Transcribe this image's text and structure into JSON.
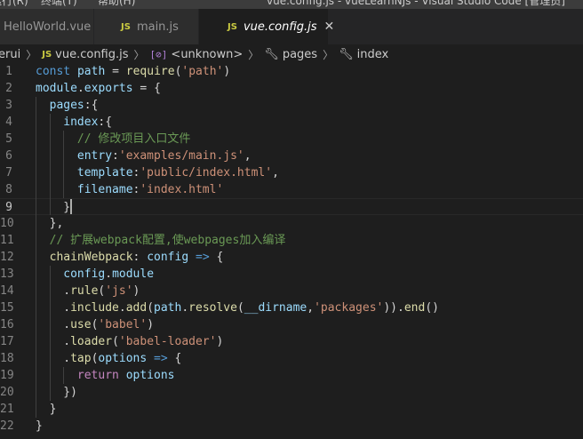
{
  "titlebar": {
    "menu_left": "运行(R)",
    "menu_right": "终端(T)",
    "menu_help": "帮助(H)",
    "window_title": "vue.config.js - vueLearnNJs - Visual Studio Code [管理员]"
  },
  "tabs": [
    {
      "label": "HelloWorld.vue",
      "icon": "",
      "active": false
    },
    {
      "label": "main.js",
      "icon": "JS",
      "active": false
    },
    {
      "label": "vue.config.js",
      "icon": "JS",
      "active": true,
      "close": "✕"
    }
  ],
  "breadcrumb": {
    "root": "erui",
    "file_icon": "JS",
    "file": "vue.config.js",
    "symbol_icon": "[⊘]",
    "symbol": "<unknown>",
    "prop1": "pages",
    "prop2": "index"
  },
  "editor": {
    "current_line": 9,
    "lines": [
      {
        "n": "1",
        "indent": 0,
        "tokens": [
          [
            "kw",
            "const "
          ],
          [
            "var",
            "path"
          ],
          [
            "op",
            " = "
          ],
          [
            "fn",
            "require"
          ],
          [
            "pun",
            "("
          ],
          [
            "str",
            "'path'"
          ],
          [
            "pun",
            ")"
          ]
        ]
      },
      {
        "n": "2",
        "indent": 0,
        "tokens": [
          [
            "var",
            "module"
          ],
          [
            "pun",
            "."
          ],
          [
            "var",
            "exports"
          ],
          [
            "op",
            " = "
          ],
          [
            "pun",
            "{"
          ]
        ]
      },
      {
        "n": "3",
        "indent": 1,
        "tokens": [
          [
            "var",
            "pages"
          ],
          [
            "pun",
            ":{"
          ]
        ]
      },
      {
        "n": "4",
        "indent": 2,
        "tokens": [
          [
            "var",
            "index"
          ],
          [
            "pun",
            ":{"
          ]
        ]
      },
      {
        "n": "5",
        "indent": 3,
        "tokens": [
          [
            "cmt",
            "// 修改项目入口文件"
          ]
        ]
      },
      {
        "n": "6",
        "indent": 3,
        "tokens": [
          [
            "var",
            "entry"
          ],
          [
            "pun",
            ":"
          ],
          [
            "str",
            "'examples/main.js'"
          ],
          [
            "pun",
            ","
          ]
        ]
      },
      {
        "n": "7",
        "indent": 3,
        "tokens": [
          [
            "var",
            "template"
          ],
          [
            "pun",
            ":"
          ],
          [
            "str",
            "'public/index.html'"
          ],
          [
            "pun",
            ","
          ]
        ]
      },
      {
        "n": "8",
        "indent": 3,
        "tokens": [
          [
            "var",
            "filename"
          ],
          [
            "pun",
            ":"
          ],
          [
            "str",
            "'index.html'"
          ]
        ]
      },
      {
        "n": "9",
        "indent": 2,
        "tokens": [
          [
            "pun",
            "}"
          ]
        ]
      },
      {
        "n": "10",
        "indent": 1,
        "tokens": [
          [
            "pun",
            "},"
          ]
        ]
      },
      {
        "n": "11",
        "indent": 1,
        "tokens": [
          [
            "cmt",
            "// 扩展webpack配置,使webpages加入编译"
          ]
        ]
      },
      {
        "n": "12",
        "indent": 1,
        "tokens": [
          [
            "fn",
            "chainWebpack"
          ],
          [
            "pun",
            ": "
          ],
          [
            "var",
            "config"
          ],
          [
            "op",
            " "
          ],
          [
            "kw",
            "=>"
          ],
          [
            "pun",
            " {"
          ]
        ]
      },
      {
        "n": "13",
        "indent": 2,
        "tokens": [
          [
            "var",
            "config"
          ],
          [
            "pun",
            "."
          ],
          [
            "var",
            "module"
          ]
        ]
      },
      {
        "n": "14",
        "indent": 2,
        "tokens": [
          [
            "pun",
            "."
          ],
          [
            "fn",
            "rule"
          ],
          [
            "pun",
            "("
          ],
          [
            "str",
            "'js'"
          ],
          [
            "pun",
            ")"
          ]
        ]
      },
      {
        "n": "15",
        "indent": 2,
        "tokens": [
          [
            "pun",
            "."
          ],
          [
            "fn",
            "include"
          ],
          [
            "pun",
            "."
          ],
          [
            "fn",
            "add"
          ],
          [
            "pun",
            "("
          ],
          [
            "var",
            "path"
          ],
          [
            "pun",
            "."
          ],
          [
            "fn",
            "resolve"
          ],
          [
            "pun",
            "("
          ],
          [
            "var",
            "__dirname"
          ],
          [
            "pun",
            ","
          ],
          [
            "str",
            "'packages'"
          ],
          [
            "pun",
            "))."
          ],
          [
            "fn",
            "end"
          ],
          [
            "pun",
            "()"
          ]
        ]
      },
      {
        "n": "16",
        "indent": 2,
        "tokens": [
          [
            "pun",
            "."
          ],
          [
            "fn",
            "use"
          ],
          [
            "pun",
            "("
          ],
          [
            "str",
            "'babel'"
          ],
          [
            "pun",
            ")"
          ]
        ]
      },
      {
        "n": "17",
        "indent": 2,
        "tokens": [
          [
            "pun",
            "."
          ],
          [
            "fn",
            "loader"
          ],
          [
            "pun",
            "("
          ],
          [
            "str",
            "'babel-loader'"
          ],
          [
            "pun",
            ")"
          ]
        ]
      },
      {
        "n": "18",
        "indent": 2,
        "tokens": [
          [
            "pun",
            "."
          ],
          [
            "fn",
            "tap"
          ],
          [
            "pun",
            "("
          ],
          [
            "var",
            "options"
          ],
          [
            "op",
            " "
          ],
          [
            "kw",
            "=>"
          ],
          [
            "pun",
            " {"
          ]
        ]
      },
      {
        "n": "19",
        "indent": 3,
        "tokens": [
          [
            "kw2",
            "return "
          ],
          [
            "var",
            "options"
          ]
        ]
      },
      {
        "n": "20",
        "indent": 2,
        "tokens": [
          [
            "pun",
            "})"
          ]
        ]
      },
      {
        "n": "21",
        "indent": 1,
        "tokens": [
          [
            "pun",
            "}"
          ]
        ]
      },
      {
        "n": "22",
        "indent": 0,
        "tokens": [
          [
            "pun",
            "}"
          ]
        ]
      }
    ]
  },
  "colors": {
    "background": "#1e1e1e",
    "tab_inactive": "#2d2d2d",
    "keyword": "#569cd6",
    "variable": "#9cdcfe",
    "function": "#dcdcaa",
    "string": "#ce9178",
    "comment": "#6a9955",
    "js_icon": "#cbcb41"
  }
}
